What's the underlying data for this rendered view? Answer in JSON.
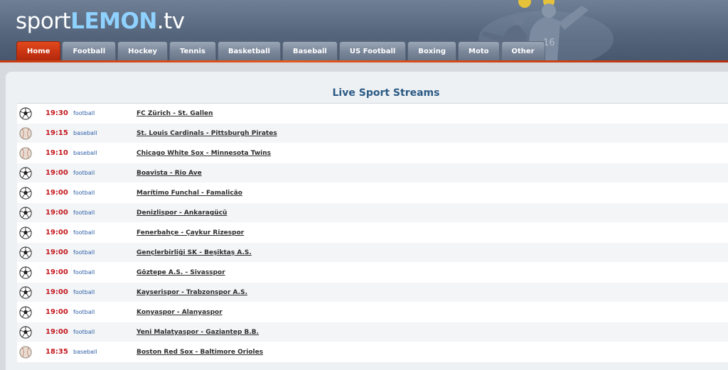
{
  "site": {
    "logo_prefix": "sport",
    "logo_brand": "LEMON",
    "logo_suffix": ".tv"
  },
  "nav": {
    "tabs": [
      {
        "label": "Home",
        "active": true
      },
      {
        "label": "Football"
      },
      {
        "label": "Hockey"
      },
      {
        "label": "Tennis"
      },
      {
        "label": "Basketball"
      },
      {
        "label": "Baseball"
      },
      {
        "label": "US Football"
      },
      {
        "label": "Boxing"
      },
      {
        "label": "Moto"
      },
      {
        "label": "Other"
      }
    ]
  },
  "main": {
    "title": "Live Sport Streams",
    "events": [
      {
        "icon": "soccer-ball-icon",
        "time": "19:30",
        "sport": "football",
        "event": "FC Zürich - St. Gallen"
      },
      {
        "icon": "baseball-icon",
        "time": "19:15",
        "sport": "baseball",
        "event": "St. Louis Cardinals - Pittsburgh Pirates"
      },
      {
        "icon": "baseball-icon",
        "time": "19:10",
        "sport": "baseball",
        "event": "Chicago White Sox - Minnesota Twins"
      },
      {
        "icon": "soccer-ball-icon",
        "time": "19:00",
        "sport": "football",
        "event": "Boavista - Rio Ave"
      },
      {
        "icon": "soccer-ball-icon",
        "time": "19:00",
        "sport": "football",
        "event": "Marítimo Funchal - Famalicão"
      },
      {
        "icon": "soccer-ball-icon",
        "time": "19:00",
        "sport": "football",
        "event": "Denizlispor - Ankaragücü"
      },
      {
        "icon": "soccer-ball-icon",
        "time": "19:00",
        "sport": "football",
        "event": "Fenerbahçe - Çaykur Rizespor"
      },
      {
        "icon": "soccer-ball-icon",
        "time": "19:00",
        "sport": "football",
        "event": "Gençlerbirliği SK - Beşiktaş A.S."
      },
      {
        "icon": "soccer-ball-icon",
        "time": "19:00",
        "sport": "football",
        "event": "Göztepe A.S. - Sivasspor"
      },
      {
        "icon": "soccer-ball-icon",
        "time": "19:00",
        "sport": "football",
        "event": "Kayserispor - Trabzonspor A.S."
      },
      {
        "icon": "soccer-ball-icon",
        "time": "19:00",
        "sport": "football",
        "event": "Konyaspor - Alanyaspor"
      },
      {
        "icon": "soccer-ball-icon",
        "time": "19:00",
        "sport": "football",
        "event": "Yeni Malatyaspor - Gaziantep B.B."
      },
      {
        "icon": "baseball-icon",
        "time": "18:35",
        "sport": "baseball",
        "event": "Boston Red Sox - Baltimore Orioles"
      }
    ]
  },
  "colors": {
    "header": "#55657c",
    "active_tab": "#c73312",
    "time": "#c4161c",
    "sport_link": "#2f5fa6",
    "title": "#2b5a84"
  }
}
